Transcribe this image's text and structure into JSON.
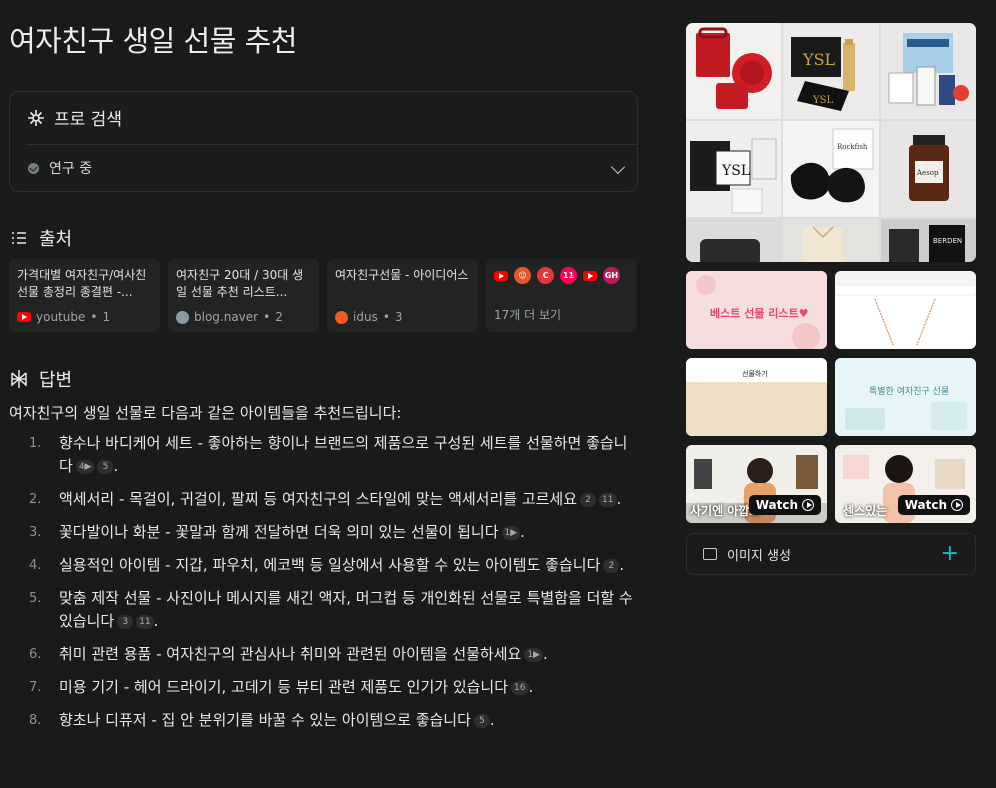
{
  "title": "여자친구 생일 선물 추천",
  "pro_search": {
    "label": "프로 검색",
    "status": "연구 중"
  },
  "sources": {
    "heading": "출처",
    "items": [
      {
        "title": "가격대별 여자친구/여사친 선물 총정리 종결편 -...",
        "site": "youtube",
        "index": "1"
      },
      {
        "title": "여자친구 20대 / 30대 생일 선물 추천 리스트...",
        "site": "blog.naver",
        "index": "2"
      },
      {
        "title": "여자친구선물 - 아이디어스",
        "site": "idus",
        "index": "3"
      }
    ],
    "more_label": "17개 더 보기",
    "more_icon_gh": "GH",
    "more_icon_c": "C",
    "more_icon_11": "11",
    "more_icon_colors": [
      "#ff0000",
      "#e4572e",
      "#e8343c",
      "#ff0050",
      "#ff0000",
      "#c2185b"
    ]
  },
  "answer": {
    "heading": "답변",
    "intro": "여자친구의 생일 선물로 다음과 같은 아이템들을 추천드립니다:",
    "items": [
      {
        "num": "1.",
        "text": "향수나 바디케어 세트 - 좋아하는 향이나 브랜드의 제품으로 구성된 세트를 선물하면 좋습니다",
        "cites": [
          "4▶",
          "5"
        ],
        "end": "."
      },
      {
        "num": "2.",
        "text": "액세서리 - 목걸이, 귀걸이, 팔찌 등 여자친구의 스타일에 맞는 액세서리를 고르세요",
        "cites": [
          "2",
          "11"
        ],
        "end": "."
      },
      {
        "num": "3.",
        "text": "꽃다발이나 화분 - 꽃말과 함께 전달하면 더욱 의미 있는 선물이 됩니다",
        "cites": [
          "1▶"
        ],
        "end": "."
      },
      {
        "num": "4.",
        "text": "실용적인 아이템 - 지갑, 파우치, 에코백 등 일상에서 사용할 수 있는 아이템도 좋습니다",
        "cites": [
          "2"
        ],
        "end": "."
      },
      {
        "num": "5.",
        "text": "맞춤 제작 선물 - 사진이나 메시지를 새긴 액자, 머그컵 등 개인화된 선물로 특별함을 더할 수 있습니다",
        "cites": [
          "3",
          "11"
        ],
        "end": "."
      },
      {
        "num": "6.",
        "text": "취미 관련 용품 - 여자친구의 관심사나 취미와 관련된 아이템을 선물하세요",
        "cites": [
          "1▶"
        ],
        "end": "."
      },
      {
        "num": "7.",
        "text": "미용 기기 - 헤어 드라이기, 고데기 등 뷰티 관련 제품도 인기가 있습니다",
        "cites": [
          "16"
        ],
        "end": "."
      },
      {
        "num": "8.",
        "text": "향초나 디퓨저 - 집 안 분위기를 바꿀 수 있는 아이템으로 좋습니다",
        "cites": [
          "5"
        ],
        "end": "."
      }
    ]
  },
  "sidebar": {
    "thumb1_text": "베스트 선물 리스트♥",
    "thumb3_text": "선물하기",
    "thumb4_text": "특별한 여자친구 선물",
    "video1_caption": "사기엔 아깝고",
    "video2_caption": "센스있는",
    "watch_label": "Watch",
    "generate_image_label": "이미지 생성",
    "plus": "+"
  }
}
